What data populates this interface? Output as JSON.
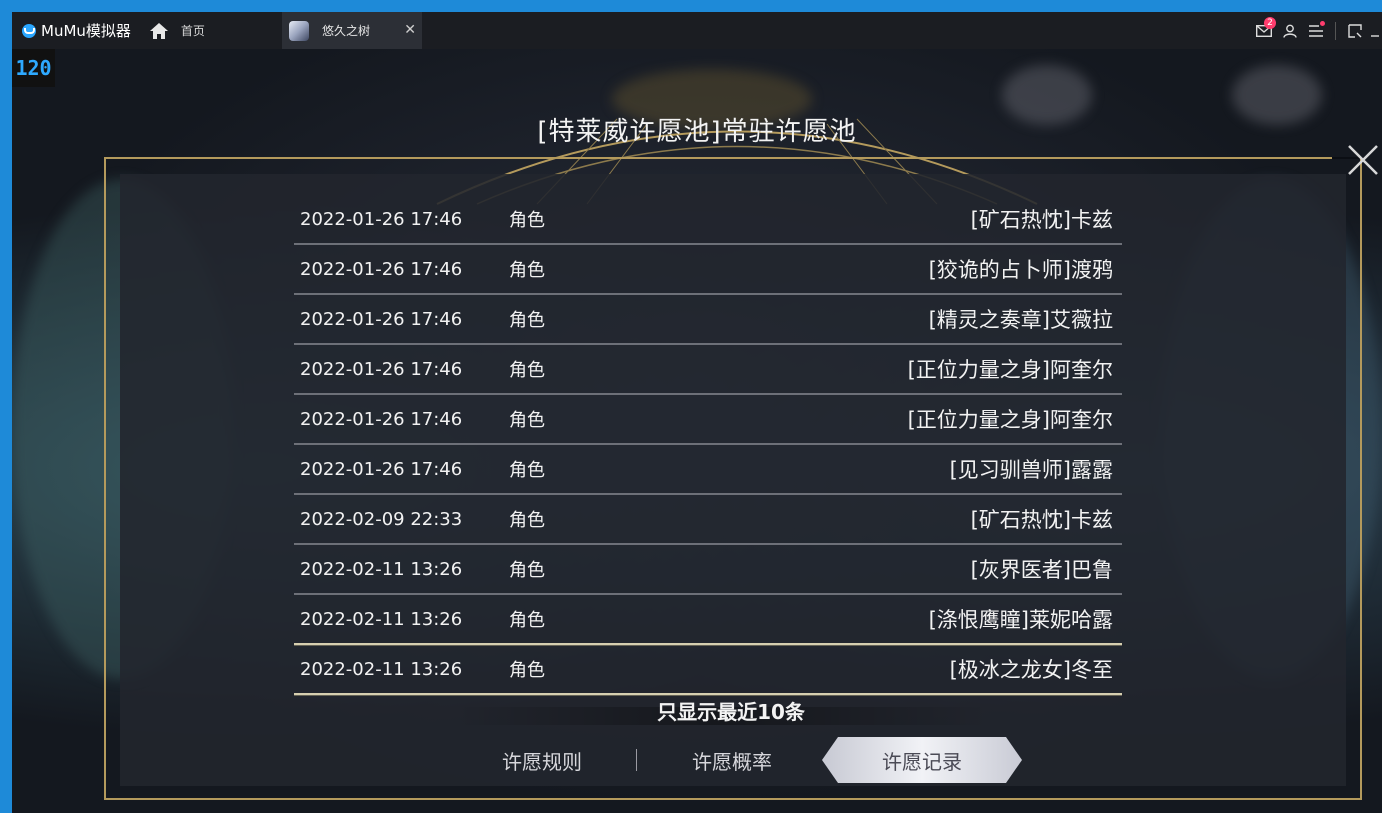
{
  "window": {
    "app_name": "MuMu模拟器",
    "home_tab_label": "首页",
    "game_tab_label": "悠久之树",
    "mail_badge_count": "2",
    "icons": [
      "mail-icon",
      "user-icon",
      "menu-icon",
      "screen-icon",
      "minimize-icon"
    ]
  },
  "fps": "120",
  "dialog": {
    "title": "[特莱威许愿池]常驻许愿池",
    "records": [
      {
        "time": "2022-01-26 17:46",
        "type": "角色",
        "name": "[矿石热忱]卡兹"
      },
      {
        "time": "2022-01-26 17:46",
        "type": "角色",
        "name": "[狡诡的占卜师]渡鸦"
      },
      {
        "time": "2022-01-26 17:46",
        "type": "角色",
        "name": "[精灵之奏章]艾薇拉"
      },
      {
        "time": "2022-01-26 17:46",
        "type": "角色",
        "name": "[正位力量之身]阿奎尔"
      },
      {
        "time": "2022-01-26 17:46",
        "type": "角色",
        "name": "[正位力量之身]阿奎尔"
      },
      {
        "time": "2022-01-26 17:46",
        "type": "角色",
        "name": "[见习驯兽师]露露"
      },
      {
        "time": "2022-02-09 22:33",
        "type": "角色",
        "name": "[矿石热忱]卡兹"
      },
      {
        "time": "2022-02-11 13:26",
        "type": "角色",
        "name": "[灰界医者]巴鲁"
      },
      {
        "time": "2022-02-11 13:26",
        "type": "角色",
        "name": "[涤恨鹰瞳]莱妮哈露"
      },
      {
        "time": "2022-02-11 13:26",
        "type": "角色",
        "name": "[极冰之龙女]冬至"
      }
    ],
    "note": "只显示最近10条",
    "tabs": {
      "rules": "许愿规则",
      "probability": "许愿概率",
      "records": "许愿记录",
      "active": "records"
    }
  },
  "colors": {
    "accent_blue": "#1e8ad8",
    "frame_gold": "#b49a5c",
    "badge_red": "#ff3d6e"
  }
}
